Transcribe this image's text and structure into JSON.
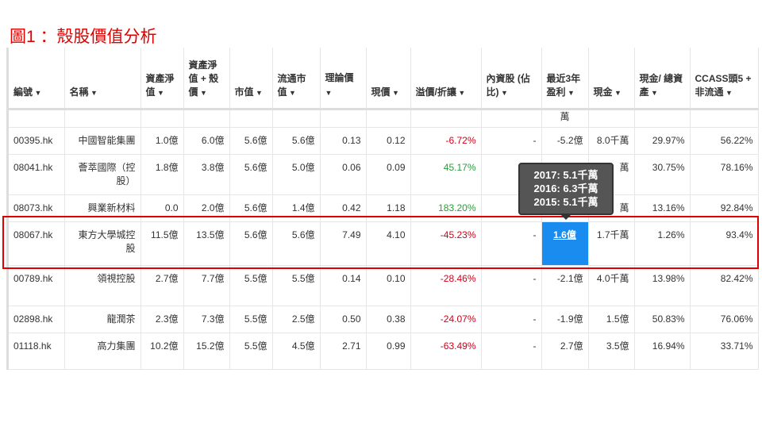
{
  "title": "圖1 ：殼股價值分析",
  "headers": [
    "編號",
    "名稱",
    "資產淨值",
    "資產淨值 + 殼價",
    "市值",
    "流通市值",
    "理論價",
    "現價",
    "溢價/折讓",
    "內資股 (佔比)",
    "最近3年 盈利",
    "現金",
    "現金/ 總資產",
    "CCASS頭5 + 非流通"
  ],
  "partial_row_text": "萬",
  "rows": [
    {
      "code": "00395.hk",
      "name": "中國智能集團",
      "nav": "1.0億",
      "nav_shell": "6.0億",
      "mcap": "5.6億",
      "float": "5.6億",
      "theory": "0.13",
      "price": "0.12",
      "prem": "-6.72%",
      "prem_color": "red",
      "domestic": "-",
      "profit": "-5.2億",
      "cash": "8.0千萬",
      "cash_ratio": "29.97%",
      "ccass": "56.22%"
    },
    {
      "code": "08041.hk",
      "name": "薈萃國際（控股）",
      "nav": "1.8億",
      "nav_shell": "3.8億",
      "mcap": "5.6億",
      "float": "5.0億",
      "theory": "0.06",
      "price": "0.09",
      "prem": "45.17%",
      "prem_color": "green",
      "domestic": "",
      "profit": "",
      "cash": "萬",
      "cash_ratio": "30.75%",
      "ccass": "78.16%"
    },
    {
      "code": "08073.hk",
      "name": "興業新材料",
      "nav": "0.0",
      "nav_shell": "2.0億",
      "mcap": "5.6億",
      "float": "1.4億",
      "theory": "0.42",
      "price": "1.18",
      "prem": "183.20%",
      "prem_color": "green",
      "domestic": "",
      "profit": "",
      "cash": "萬",
      "cash_ratio": "13.16%",
      "ccass": "92.84%"
    },
    {
      "code": "08067.hk",
      "name": "東方大學城控股",
      "nav": "11.5億",
      "nav_shell": "13.5億",
      "mcap": "5.6億",
      "float": "5.6億",
      "theory": "7.49",
      "price": "4.10",
      "prem": "-45.23%",
      "prem_color": "red",
      "domestic": "-",
      "profit": "1.6億",
      "cash": "1.7千萬",
      "cash_ratio": "1.26%",
      "ccass": "93.4%",
      "highlight": true
    },
    {
      "code": "00789.hk",
      "name": "領視控股",
      "nav": "2.7億",
      "nav_shell": "7.7億",
      "mcap": "5.5億",
      "float": "5.5億",
      "theory": "0.14",
      "price": "0.10",
      "prem": "-28.46%",
      "prem_color": "red",
      "domestic": "-",
      "profit": "-2.1億",
      "cash": "4.0千萬",
      "cash_ratio": "13.98%",
      "ccass": "82.42%"
    },
    {
      "code": "02898.hk",
      "name": "龍潤茶",
      "nav": "2.3億",
      "nav_shell": "7.3億",
      "mcap": "5.5億",
      "float": "2.5億",
      "theory": "0.50",
      "price": "0.38",
      "prem": "-24.07%",
      "prem_color": "red",
      "domestic": "-",
      "profit": "-1.9億",
      "cash": "1.5億",
      "cash_ratio": "50.83%",
      "ccass": "76.06%"
    },
    {
      "code": "01118.hk",
      "name": "高力集團",
      "nav": "10.2億",
      "nav_shell": "15.2億",
      "mcap": "5.5億",
      "float": "4.5億",
      "theory": "2.71",
      "price": "0.99",
      "prem": "-63.49%",
      "prem_color": "red",
      "domestic": "-",
      "profit": "2.7億",
      "cash": "3.5億",
      "cash_ratio": "16.94%",
      "ccass": "33.71%"
    }
  ],
  "tooltip": [
    "2017: 5.1千萬",
    "2016: 6.3千萬",
    "2015: 5.1千萬"
  ],
  "colors": {
    "negative": "#d0021b",
    "positive": "#2a9d3a",
    "highlight": "#1a8cf0",
    "annotation": "#e00000"
  }
}
